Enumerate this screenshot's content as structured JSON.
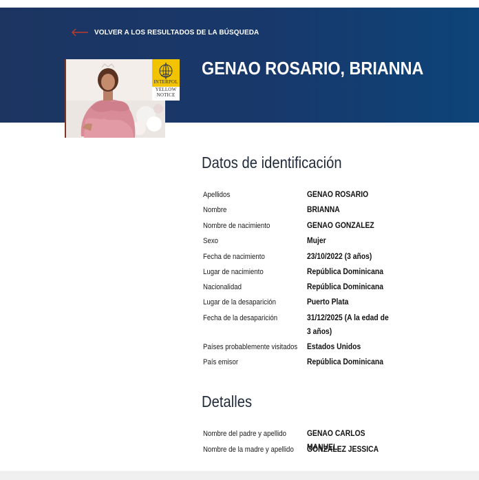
{
  "back_link": {
    "label": "VOLVER A LOS RESULTADOS DE LA BÚSQUEDA"
  },
  "notice": {
    "title": "GENAO ROSARIO, BRIANNA",
    "badge": {
      "org": "INTERPOL",
      "line1": "YELLOW",
      "line2": "NOTICE"
    }
  },
  "identification": {
    "heading": "Datos de identificación",
    "rows": [
      {
        "label": "Apellidos",
        "value": "GENAO ROSARIO"
      },
      {
        "label": "Nombre",
        "value": "BRIANNA"
      },
      {
        "label": "Nombre de nacimiento",
        "value": "GENAO GONZALEZ"
      },
      {
        "label": "Sexo",
        "value": "Mujer"
      },
      {
        "label": "Fecha de nacimiento",
        "value": "23/10/2022 (3 años)"
      },
      {
        "label": "Lugar de nacimiento",
        "value": "República Dominicana"
      },
      {
        "label": "Nacionalidad",
        "value": "República Dominicana"
      },
      {
        "label": "Lugar de la desaparición",
        "value": "Puerto Plata"
      },
      {
        "label": "Fecha de la desaparición",
        "value": "31/12/2025 (A la edad de 3 años)"
      },
      {
        "label": "Países probablemente visitados",
        "value": "Estados Unidos"
      },
      {
        "label": "País emisor",
        "value": "República Dominicana"
      }
    ]
  },
  "details": {
    "heading": "Detalles",
    "rows": [
      {
        "label": "Nombre del padre y apellido",
        "value": "GENAO CARLOS MANUEL"
      },
      {
        "label": "Nombre de la madre y apellido",
        "value": "GONZALEZ JESSICA"
      }
    ]
  },
  "colors": {
    "header_start": "#1c3561",
    "header_end": "#0d4479",
    "badge": "#f2c400",
    "arrow": "#c0392b"
  }
}
